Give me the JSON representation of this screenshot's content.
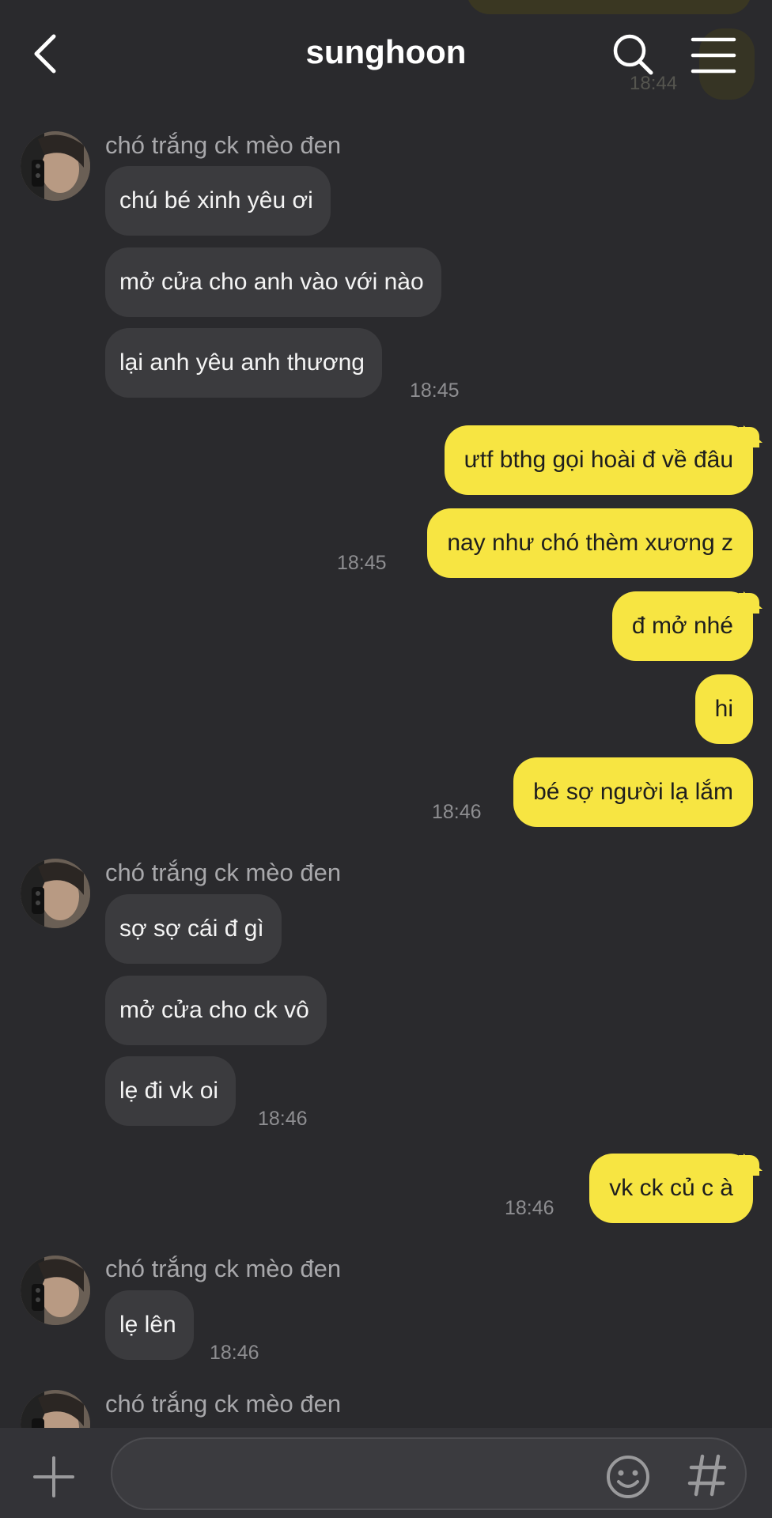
{
  "header": {
    "title": "sunghoon",
    "ghost_time": "18:44"
  },
  "sender_name": "chó trắng ck mèo đen",
  "messages": {
    "m1": "chú bé xinh yêu ơi",
    "m2": "mở cửa cho anh vào với nào",
    "m3": "lại anh yêu anh thương",
    "t1": "18:45",
    "o1": "ưtf bthg gọi hoài đ về đâu",
    "o2": "nay như chó thèm xương z",
    "t2": "18:45",
    "o3": "đ mở nhé",
    "o4": "hi",
    "o5": "bé sợ người lạ lắm",
    "t3": "18:46",
    "m4": "sợ sợ cái đ gì",
    "m5": "mở cửa cho ck vô",
    "m6": "lẹ đi vk oi",
    "t4": "18:46",
    "o6": "vk ck củ c à",
    "t5": "18:46",
    "m7": "lẹ lên",
    "t6": "18:46"
  },
  "colors": {
    "background": "#2a2a2d",
    "outgoing": "#f7e542",
    "incoming": "#3b3b3e"
  },
  "icons": [
    "back-icon",
    "search-icon",
    "menu-icon",
    "plus-icon",
    "emoji-icon",
    "hashtag-icon"
  ]
}
